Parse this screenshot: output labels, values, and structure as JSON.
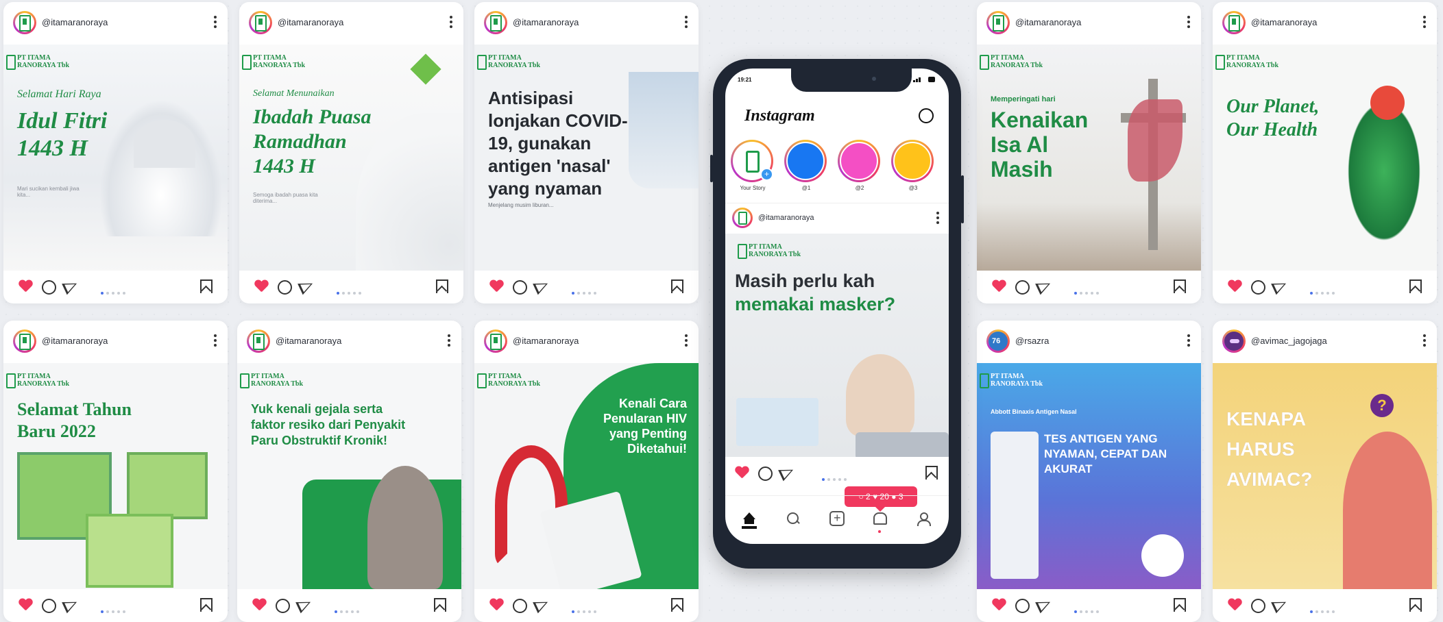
{
  "cards": [
    {
      "user": "@itamaranoraya",
      "brand": "PT ITAMA RANORAYA Tbk",
      "pre": "Selamat Hari Raya",
      "headline": "Idul Fitri 1443 H",
      "body": "Mari sucikan kembali jiwa kita..."
    },
    {
      "user": "@itamaranoraya",
      "brand": "PT ITAMA RANORAYA Tbk",
      "pre": "Selamat Menunaikan",
      "headline": "Ibadah Puasa Ramadhan 1443 H",
      "body": "Semoga ibadah puasa kita diterima..."
    },
    {
      "user": "@itamaranoraya",
      "brand": "PT ITAMA RANORAYA Tbk",
      "pre": "",
      "headline": "Antisipasi lonjakan COVID-19, gunakan antigen 'nasal' yang nyaman",
      "body": "Menjelang musim liburan..."
    },
    {
      "user": "@itamaranoraya",
      "brand": "PT ITAMA RANORAYA Tbk",
      "pre": "Memperingati hari",
      "headline": "Kenaikan Isa Al Masih",
      "body": ""
    },
    {
      "user": "@itamaranoraya",
      "brand": "PT ITAMA RANORAYA Tbk",
      "pre": "",
      "headline": "Our Planet, Our Health",
      "body": ""
    },
    {
      "user": "@itamaranoraya",
      "brand": "PT ITAMA RANORAYA Tbk",
      "pre": "",
      "headline": "Selamat Tahun Baru 2022",
      "body": ""
    },
    {
      "user": "@itamaranoraya",
      "brand": "PT ITAMA RANORAYA Tbk",
      "pre": "",
      "headline": "Yuk kenali gejala serta faktor resiko dari Penyakit Paru Obstruktif Kronik!",
      "body": ""
    },
    {
      "user": "@itamaranoraya",
      "brand": "PT ITAMA RANORAYA Tbk",
      "pre": "",
      "headline": "Kenali Cara Penularan HIV yang Penting Diketahui!",
      "body": ""
    },
    {
      "user": "@rsazra",
      "brand": "PT ITAMA RANORAYA Tbk",
      "pre": "Abbott Binaxis Antigen Nasal",
      "headline": "TES ANTIGEN YANG NYAMAN, CEPAT DAN AKURAT",
      "body": ""
    },
    {
      "user": "@avimac_jagojaga",
      "brand": "",
      "pre": "",
      "headline": "KENAPA HARUS AVIMAC?",
      "body": ""
    }
  ],
  "phone": {
    "time": "19:21",
    "app_title": "Instagram",
    "stories": [
      {
        "label": "Your Story"
      },
      {
        "label": "@1"
      },
      {
        "label": "@2"
      },
      {
        "label": "@3"
      }
    ],
    "post": {
      "user": "@itamaranoraya",
      "brand": "PT ITAMA RANORAYA Tbk",
      "headline_a": "Masih perlu kah",
      "headline_b": "memakai masker?"
    },
    "notif": {
      "comments": "2",
      "likes": "20",
      "follows": "3"
    }
  }
}
